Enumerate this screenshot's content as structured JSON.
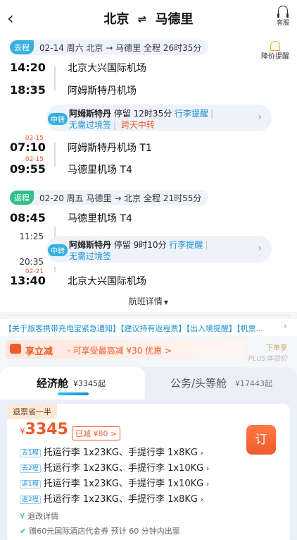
{
  "header": {
    "from": "北京",
    "arrows": "⇌",
    "to": "马德里",
    "cs_label": "客服"
  },
  "outbound": {
    "tag": "去程",
    "info": "02-14 周六   北京 → 马德里   全程 26时35分",
    "bell_label": "降价提醒",
    "legs": [
      {
        "time": "14:20",
        "airport": "北京大兴国际机场"
      },
      {
        "time": "18:35",
        "airport": "阿姆斯特丹机场"
      },
      {
        "time": "07:10",
        "date": "02-15",
        "airport": "阿姆斯特丹机场 T1"
      },
      {
        "time": "09:55",
        "date": "02-15",
        "airport": "马德里机场 T4"
      }
    ],
    "transfer": {
      "badge": "中转",
      "city": "阿姆斯特丹",
      "stay": "停留 12时35分",
      "link": "行李提醒",
      "note1": "无需过境签",
      "note2": "跨天中转"
    }
  },
  "return": {
    "tag": "返程",
    "info": "02-20 周五   马德里 → 北京   全程 21时55分",
    "legs": [
      {
        "time": "08:45",
        "airport": "马德里机场 T4"
      },
      {
        "time": "11:25"
      },
      {
        "time": "20:35"
      },
      {
        "time": "13:40",
        "date": "02-21",
        "airport": "北京大兴国际机场"
      }
    ],
    "transfer": {
      "badge": "中转",
      "city": "阿姆斯特丹",
      "stay": "停留 9时10分",
      "link": "行李提醒",
      "note1": "无需过境签"
    }
  },
  "details_label": "航班详情",
  "notice": "【关于旅客携带充电宝紧急通知】【建议持有返程票】【出入境提醒】【机票...",
  "promo": {
    "title": "享立减",
    "text": "· 可享受最高减 ¥30 优惠  >"
  },
  "plus": {
    "line1": "下单享",
    "line2": "PLUS体验价"
  },
  "tabs": {
    "economy": {
      "label": "经济舱",
      "price": "¥3345起"
    },
    "business": {
      "label": "公务/头等舱",
      "price": "¥17443起"
    }
  },
  "offer": {
    "refund_tag": "退票省一半",
    "currency": "¥",
    "price": "3345",
    "reduced": "已减 ¥80 >",
    "book_label": "订",
    "bags": [
      {
        "tag": "去1程",
        "text": "托运行李 1x23KG、手提行李 1x8KG"
      },
      {
        "tag": "去2程",
        "text": "托运行李 1x23KG、手提行李 1x10KG"
      },
      {
        "tag": "返1程",
        "text": "托运行李 1x23KG、手提行李 1x10KG"
      },
      {
        "tag": "返2程",
        "text": "托运行李 1x23KG、手提行李 1x8KG"
      }
    ],
    "change_label": "退改详情",
    "voucher": "赠60元国际酒店代金券  预计 60 分钟内出票"
  }
}
